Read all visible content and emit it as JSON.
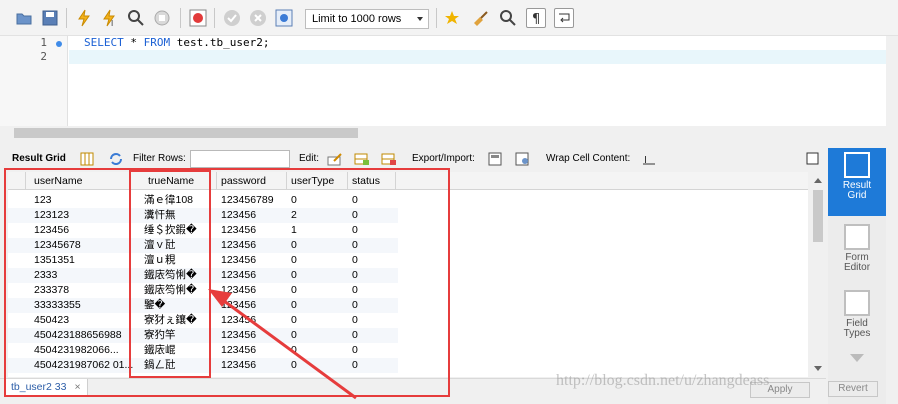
{
  "toolbar": {
    "limit_label": "Limit to 1000 rows",
    "icons": [
      "folder-icon",
      "save-icon",
      "lightning-icon",
      "lightning-cursor-icon",
      "magnify-icon",
      "stop-icon",
      "toggle-error-icon",
      "commit-icon",
      "rollback-icon",
      "autocommit-icon",
      "bookmark-star-icon",
      "broom-icon",
      "find-icon",
      "paragraph-icon",
      "wrap-icon"
    ]
  },
  "editor": {
    "line_numbers": [
      "1",
      "2"
    ],
    "sql": {
      "kw1": "SELECT",
      "star": " * ",
      "kw2": "FROM",
      "rest": " test.tb_user2;"
    }
  },
  "result_toolbar": {
    "result_grid": "Result Grid",
    "filter_rows": "Filter Rows:",
    "edit": "Edit:",
    "export_import": "Export/Import:",
    "wrap_cell": "Wrap Cell Content:"
  },
  "grid": {
    "columns": [
      "userName",
      "trueName",
      "password",
      "userType",
      "status"
    ],
    "rows": [
      [
        "123",
        "滿ｅ徫108",
        "123456789",
        "0",
        "0"
      ],
      [
        "123123",
        "瀵忓無",
        "123456",
        "2",
        "0"
      ],
      [
        "123456",
        "缍＄扻鍜�",
        "123456",
        "1",
        "0"
      ],
      [
        "12345678",
        "澶ｖ瓧",
        "123456",
        "0",
        "0"
      ],
      [
        "1351351",
        "澶ｕ粯",
        "123456",
        "0",
        "0"
      ],
      [
        "2333",
        "鐵庡笉悧�",
        "123456",
        "0",
        "0"
      ],
      [
        "233378",
        "鐵庡笉悧�",
        "123456",
        "0",
        "0"
      ],
      [
        "33333355",
        "鑒�",
        "123456",
        "0",
        "0"
      ],
      [
        "450423",
        "寮犲ぇ鑲�",
        "123456",
        "0",
        "0"
      ],
      [
        "450423188656988",
        "寮犳竿",
        "123456",
        "0",
        "0"
      ],
      [
        "4504231982066...",
        "鐵庡崐",
        "123456",
        "0",
        "0"
      ],
      [
        "4504231987062 01...",
        "鍋ㄥ瓧",
        "123456",
        "0",
        "0"
      ],
      [
        "",
        "",
        "",
        "",
        ""
      ]
    ]
  },
  "side_panel": {
    "items": [
      {
        "label1": "Result",
        "label2": "Grid"
      },
      {
        "label1": "Form",
        "label2": "Editor"
      },
      {
        "label1": "Field",
        "label2": "Types"
      }
    ]
  },
  "bottom": {
    "tab_label": "tb_user2 33",
    "tab_close": "×",
    "apply": "Apply",
    "revert": "Revert"
  },
  "watermark": "http://blog.csdn.net/u/zhangdeass",
  "colors": {
    "highlight_box": "#e63c3c",
    "active_panel": "#1e7ad8",
    "sql_keyword": "#1b60d4"
  }
}
